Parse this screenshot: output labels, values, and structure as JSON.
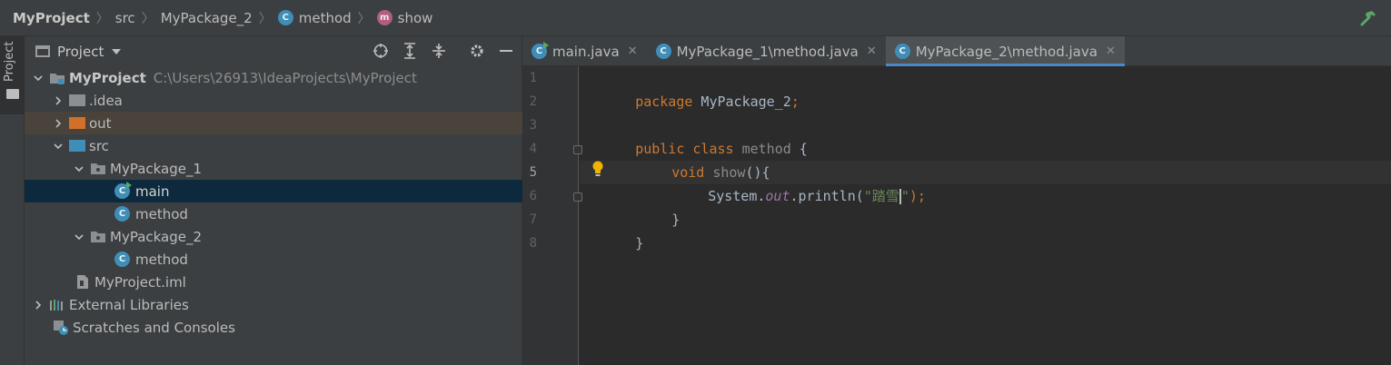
{
  "breadcrumb": {
    "project": "MyProject",
    "src": "src",
    "package": "MyPackage_2",
    "class": "method",
    "method": "show",
    "class_icon": "C",
    "method_icon": "m"
  },
  "sidebar_strip": {
    "label": "Project"
  },
  "project_panel": {
    "title": "Project",
    "tree": {
      "root": {
        "label": "MyProject",
        "path": "C:\\Users\\26913\\IdeaProjects\\MyProject"
      },
      "idea": ".idea",
      "out": "out",
      "src": "src",
      "pkg1": "MyPackage_1",
      "pkg1_main": "main",
      "pkg1_method": "method",
      "pkg2": "MyPackage_2",
      "pkg2_method": "method",
      "iml": "MyProject.iml",
      "ext_libs": "External Libraries",
      "scratches": "Scratches and Consoles",
      "class_icon": "C"
    }
  },
  "tabs": [
    {
      "label": "main.java",
      "close": "✕"
    },
    {
      "label": "MyPackage_1\\method.java",
      "close": "✕"
    },
    {
      "label": "MyPackage_2\\method.java",
      "close": "✕"
    }
  ],
  "editor": {
    "line_numbers": [
      "1",
      "2",
      "3",
      "4",
      "5",
      "6",
      "7",
      "8"
    ],
    "current_line": 5,
    "code": {
      "l1_kw": "package",
      "l1_rest": " MyPackage_2",
      "l1_semi": ";",
      "l3_kw": "public class",
      "l3_name": " method",
      "l3_brace": " {",
      "l4_kw": "void",
      "l4_name": " show",
      "l4_rest": "(){",
      "l5_a": "System.",
      "l5_field": "out",
      "l5_b": ".println(",
      "l5_str1": "\"踏雪",
      "l5_str2": "\"",
      "l5_end": ");",
      "l6": "}",
      "l7": "}"
    }
  },
  "colors": {
    "accent": "#4a88c7",
    "keyword": "#cc7832",
    "string": "#6a8759",
    "field": "#9876aa",
    "selection": "#0d293e"
  }
}
